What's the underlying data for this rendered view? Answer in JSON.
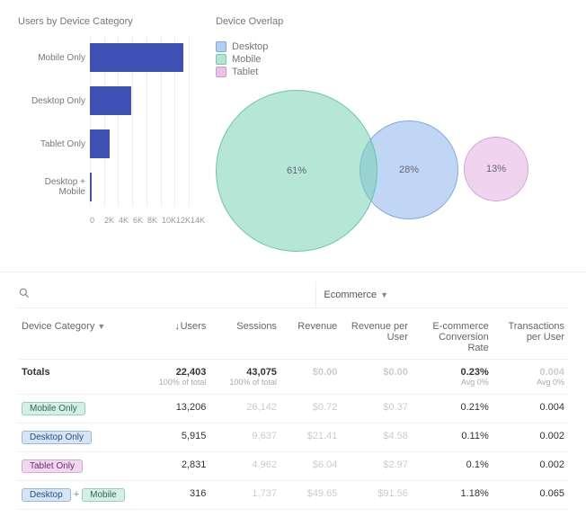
{
  "bar_panel": {
    "title": "Users by Device Category"
  },
  "venn_panel": {
    "title": "Device Overlap",
    "legend": {
      "desktop": "Desktop",
      "mobile": "Mobile",
      "tablet": "Tablet"
    },
    "labels": {
      "mobile_pct": "61%",
      "desktop_pct": "28%",
      "tablet_pct": "13%"
    }
  },
  "table": {
    "group_selector": "Ecommerce",
    "columns": {
      "device": "Device Category",
      "users": "Users",
      "sessions": "Sessions",
      "revenue": "Revenue",
      "rev_per_user": "Revenue per User",
      "conv_rate": "E-commerce Conversion Rate",
      "tx_per_user": "Transactions per User"
    },
    "totals_label": "Totals",
    "totals": {
      "users": "22,403",
      "users_sub": "100% of total",
      "sessions": "43,075",
      "sessions_sub": "100% of total",
      "revenue": "$0.00",
      "rev_per_user": "$0.00",
      "conv_rate": "0.23%",
      "conv_rate_sub": "Avg 0%",
      "tx_per_user": "0.004",
      "tx_per_user_sub": "Avg 0%"
    },
    "rows": [
      {
        "tags": [
          {
            "label": "Mobile Only",
            "cls": "mobile"
          }
        ],
        "users": "13,206",
        "sessions": "26,142",
        "revenue": "$0.72",
        "rev_per_user": "$0.37",
        "conv_rate": "0.21%",
        "tx_per_user": "0.004"
      },
      {
        "tags": [
          {
            "label": "Desktop Only",
            "cls": "desktop"
          }
        ],
        "users": "5,915",
        "sessions": "9,637",
        "revenue": "$21.41",
        "rev_per_user": "$4.58",
        "conv_rate": "0.11%",
        "tx_per_user": "0.002"
      },
      {
        "tags": [
          {
            "label": "Tablet Only",
            "cls": "tablet"
          }
        ],
        "users": "2,831",
        "sessions": "4,962",
        "revenue": "$6.04",
        "rev_per_user": "$2.97",
        "conv_rate": "0.1%",
        "tx_per_user": "0.002"
      },
      {
        "tags": [
          {
            "label": "Desktop",
            "cls": "desktop"
          },
          {
            "label": "Mobile",
            "cls": "mobile"
          }
        ],
        "users": "316",
        "sessions": "1,737",
        "revenue": "$49.65",
        "rev_per_user": "$91.56",
        "conv_rate": "1.18%",
        "tx_per_user": "0.065"
      }
    ]
  },
  "chart_data": [
    {
      "type": "bar",
      "title": "Users by Device Category",
      "orientation": "horizontal",
      "categories": [
        "Mobile Only",
        "Desktop Only",
        "Tablet Only",
        "Desktop + Mobile"
      ],
      "values": [
        13206,
        5915,
        2831,
        316
      ],
      "xlabel": "",
      "ylabel": "",
      "xlim": [
        0,
        14000
      ],
      "xticks": [
        0,
        2000,
        4000,
        6000,
        8000,
        10000,
        12000,
        14000
      ],
      "xtick_labels": [
        "0",
        "2K",
        "4K",
        "6K",
        "8K",
        "10K",
        "12K",
        "14K"
      ]
    },
    {
      "type": "venn",
      "title": "Device Overlap",
      "sets": [
        {
          "name": "Mobile",
          "percentage": 61,
          "color": "#8fd4bd"
        },
        {
          "name": "Desktop",
          "percentage": 28,
          "color": "#94b9e6"
        },
        {
          "name": "Tablet",
          "percentage": 13,
          "color": "#d8a8d8"
        }
      ],
      "overlaps": [
        {
          "sets": [
            "Mobile",
            "Desktop"
          ],
          "present": true
        },
        {
          "sets": [
            "Desktop",
            "Tablet"
          ],
          "present": true
        }
      ]
    }
  ]
}
